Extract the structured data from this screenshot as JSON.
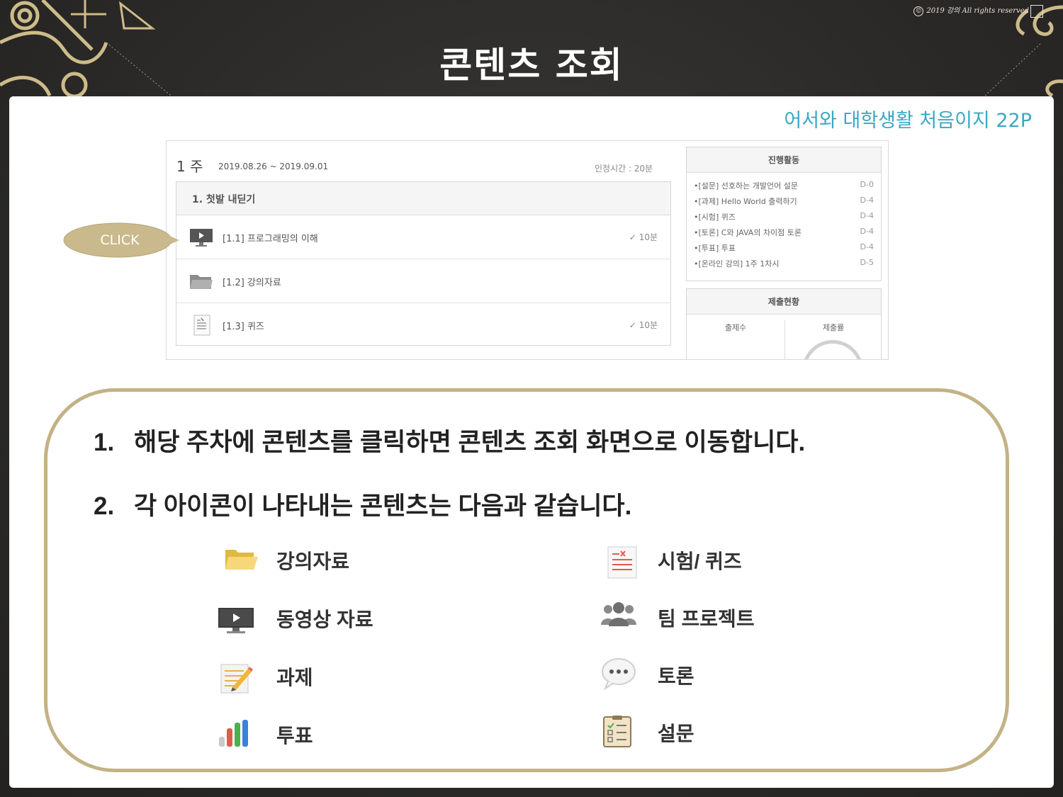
{
  "copyright": {
    "symbol": "©",
    "text": "2019 강의 All rights reserved"
  },
  "title": "콘텐츠 조회",
  "reference": "어서와 대학생활 처음이지 22P",
  "lms": {
    "week_label": "1 주",
    "date_range": "2019.08.26 ~ 2019.09.01",
    "recognized_time": "인정시간 : 20분",
    "module_title": "1. 첫발 내딛기",
    "items": [
      {
        "label": "[1.1] 프로그래밍의 이해",
        "icon": "monitor-video-icon",
        "time": "10분",
        "check": "✓"
      },
      {
        "label": "[1.2] 강의자료",
        "icon": "folder-icon",
        "time": "",
        "check": ""
      },
      {
        "label": "[1.3] 퀴즈",
        "icon": "quiz-sheet-icon",
        "time": "10분",
        "check": "✓"
      }
    ],
    "activities_title": "진행활동",
    "activities": [
      {
        "text": "•[설문] 선호하는 개발언어 설문",
        "due": "D-0"
      },
      {
        "text": "•[과제] Hello World 출력하기",
        "due": "D-4"
      },
      {
        "text": "•[시험] 퀴즈",
        "due": "D-4"
      },
      {
        "text": "•[토론] C와 JAVA의 차이점 토론",
        "due": "D-4"
      },
      {
        "text": "•[투표] 투표",
        "due": "D-4"
      },
      {
        "text": "•[온라인 강의] 1주 1차시",
        "due": "D-5"
      }
    ],
    "submission_title": "제출현황",
    "submission_cols": [
      "출제수",
      "제출률"
    ]
  },
  "click_label": "CLICK",
  "steps": [
    {
      "num": "1.",
      "text": "해당 주차에 콘텐츠를 클릭하면 콘텐츠 조회 화면으로 이동합니다."
    },
    {
      "num": "2.",
      "text": "각 아이콘이 나타내는 콘텐츠는 다음과 같습니다."
    }
  ],
  "legend": [
    {
      "label": "강의자료",
      "icon": "folder-icon"
    },
    {
      "label": "동영상 자료",
      "icon": "monitor-video-icon"
    },
    {
      "label": "과제",
      "icon": "assignment-pencil-icon"
    },
    {
      "label": "투표",
      "icon": "vote-bar-chart-icon"
    },
    {
      "label": "시험/ 퀴즈",
      "icon": "quiz-sheet-icon"
    },
    {
      "label": "팀 프로젝트",
      "icon": "team-people-icon"
    },
    {
      "label": "토론",
      "icon": "discussion-bubble-icon"
    },
    {
      "label": "설문",
      "icon": "survey-clipboard-icon"
    }
  ],
  "colors": {
    "background": "#2e2d2b",
    "reference_text": "#3aa7c3",
    "frame_border": "#c3b285",
    "click_bubble": "#c9b98c"
  }
}
